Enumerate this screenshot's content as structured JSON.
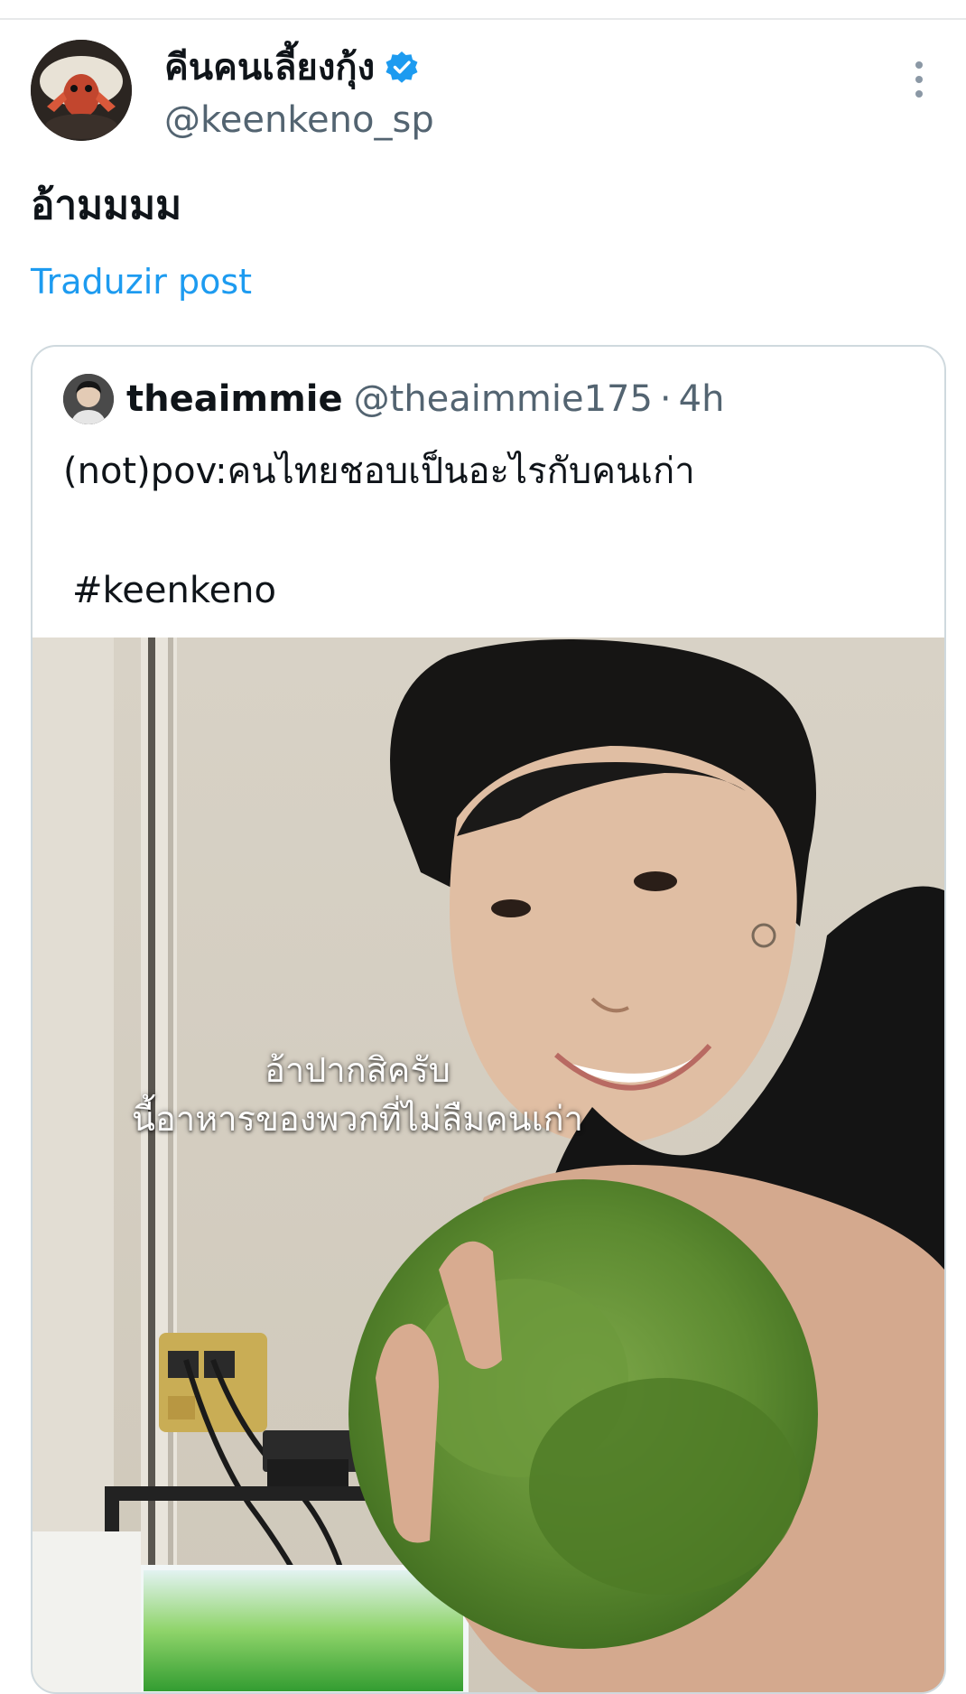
{
  "post": {
    "author_name": "คีนคนเลี้ยงกุ้ง",
    "author_handle": "@keenkeno_sp",
    "text": "อ้ามมมม",
    "translate_label": "Traduzir post",
    "avatar_icon": "shrimp-avatar-icon",
    "verified_icon": "verified-badge-icon",
    "more_icon": "more-options-icon"
  },
  "quoted": {
    "author_name": "theaimmie",
    "author_handle": "@theaimmie175",
    "separator": "·",
    "time": "4h",
    "text": "(not)pov:คนไทยชอบเป็นอะไรกับคนเก่า",
    "hashtag": "#keenkeno",
    "media": {
      "caption_line1": "อ้าปากสิครับ",
      "caption_line2": "นี้อาหารของพวกที่ไม่ลืมคนเก่า"
    }
  },
  "colors": {
    "link": "#1d9bf0",
    "verified": "#1d9bf0",
    "secondary_text": "#536471",
    "border": "#cfd9de"
  }
}
